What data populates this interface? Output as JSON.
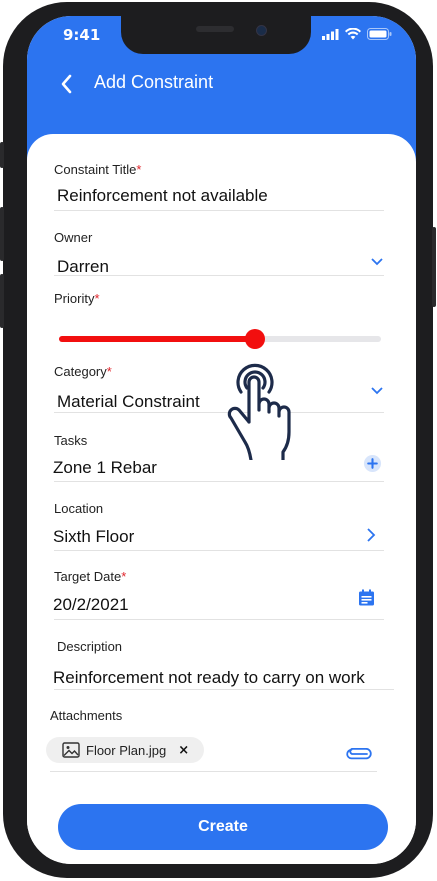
{
  "status_bar": {
    "time": "9:41"
  },
  "header": {
    "title": "Add Constraint"
  },
  "form": {
    "title_field": {
      "label": "Constaint Title",
      "required_mark": "*",
      "value": "Reinforcement not available"
    },
    "owner_field": {
      "label": "Owner",
      "value": "Darren"
    },
    "priority_field": {
      "label": "Priority",
      "required_mark": "*",
      "level": 0.61
    },
    "category_field": {
      "label": "Category",
      "required_mark": "*",
      "value": "Material Constraint"
    },
    "tasks_field": {
      "label": "Tasks",
      "value": "Zone 1 Rebar"
    },
    "location_field": {
      "label": "Location",
      "value": "Sixth Floor"
    },
    "target_date_field": {
      "label": "Target Date",
      "required_mark": "*",
      "value": "20/2/2021"
    },
    "description_field": {
      "label": "Description",
      "value": "Reinforcement not ready to carry on work"
    },
    "attachments_field": {
      "label": "Attachments",
      "files": [
        {
          "name": "Floor Plan.jpg",
          "remove": "×"
        }
      ]
    }
  },
  "actions": {
    "create_label": "Create"
  },
  "colors": {
    "accent": "#2c74f0",
    "priority": "#f20f0f",
    "required": "#e0242b"
  },
  "icons": [
    "back-chevron-icon",
    "chevron-down-icon",
    "add-circle-icon",
    "chevron-right-icon",
    "calendar-icon",
    "image-icon",
    "paperclip-icon",
    "tap-hand-icon"
  ]
}
